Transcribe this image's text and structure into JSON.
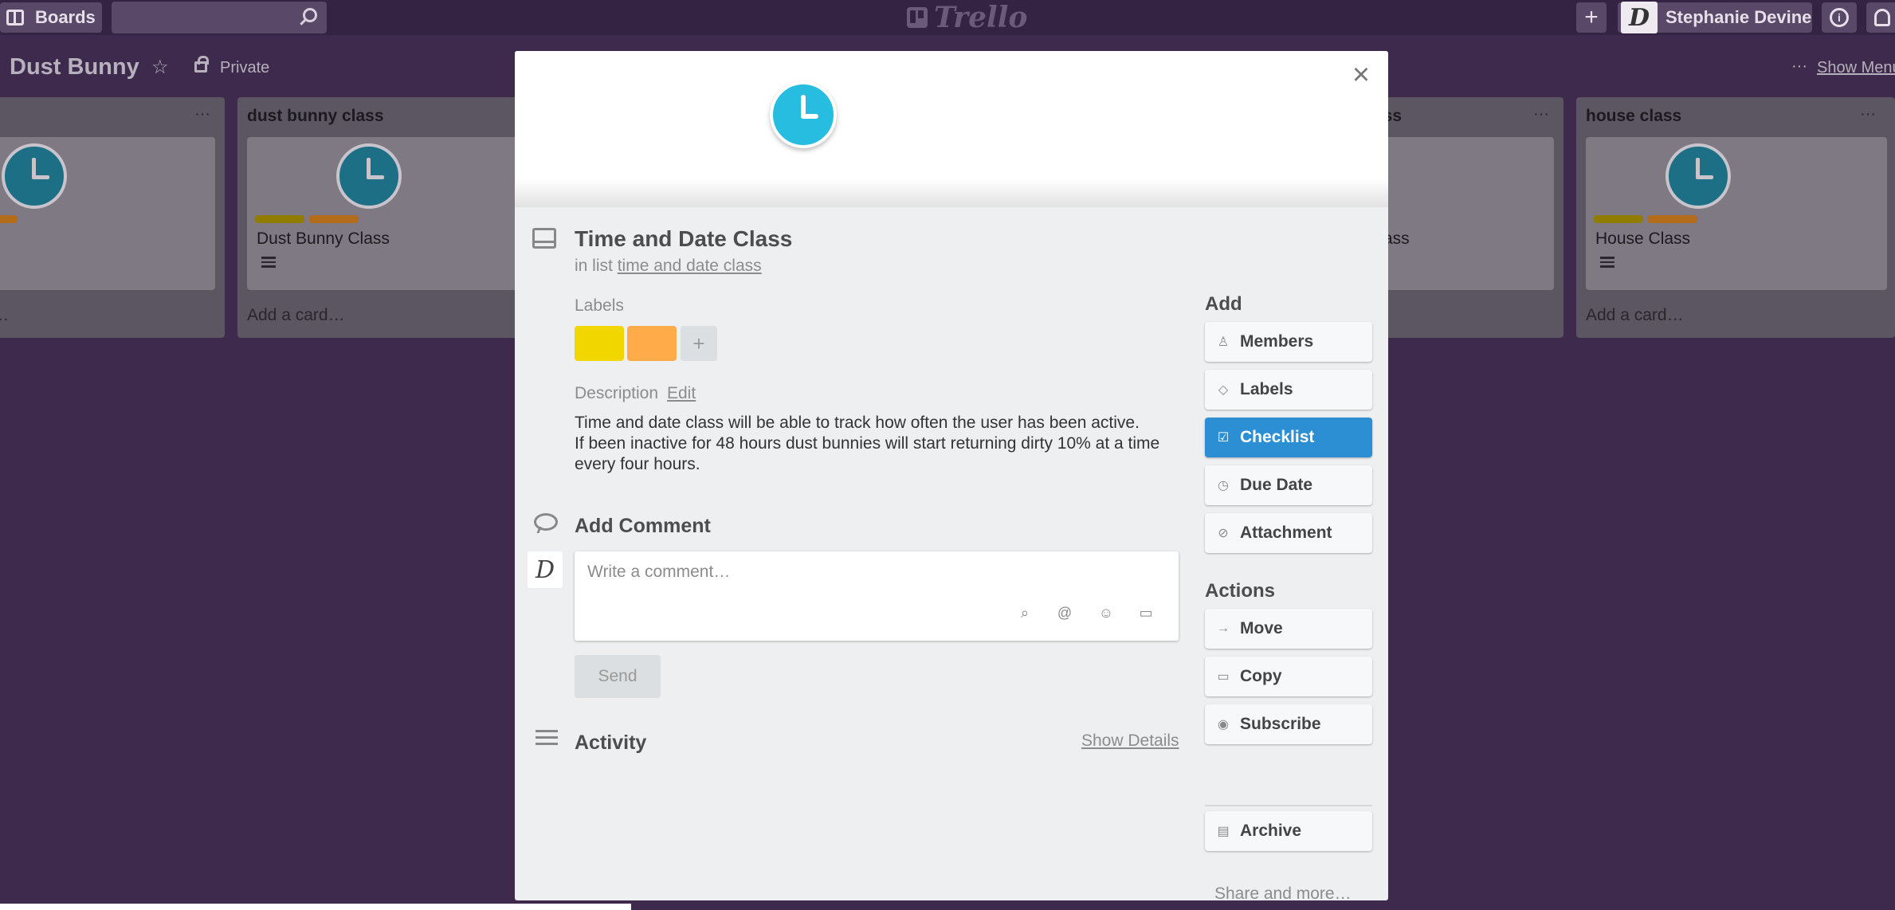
{
  "topbar": {
    "boards_label": "Boards",
    "search_placeholder": "",
    "logo_text": "Trello",
    "user_name": "Stephanie Devine",
    "user_initial": "D",
    "plus_label": "+",
    "info_label": "i"
  },
  "board": {
    "title": "Dust Bunny",
    "privacy": "Private",
    "menu_dots": "···",
    "show_menu": "Show Menu"
  },
  "lists": [
    {
      "title": "",
      "card_title": "",
      "add_card": "Add a card…",
      "label_colors": [
        "#b36d1a"
      ]
    },
    {
      "title": "dust bunny class",
      "card_title": "Dust Bunny Class",
      "add_card": "Add a card…",
      "label_colors": [
        "#8f7c00",
        "#b36d1a"
      ]
    },
    {
      "title": "ass",
      "card_title": "ass",
      "add_card": ""
    },
    {
      "title": "house class",
      "card_title": "House Class",
      "add_card": "Add a card…",
      "label_colors": [
        "#8f7c00",
        "#b36d1a"
      ]
    }
  ],
  "card": {
    "title": "Time and Date Class",
    "in_list_prefix": "in list",
    "list_name": "time and date class",
    "labels_heading": "Labels",
    "label_colors": [
      "#f2d600",
      "#ffab4a"
    ],
    "add_label": "+",
    "description_heading": "Description",
    "edit_link": "Edit",
    "description_line1": "Time and date class will be able to track how often the user has been active.",
    "description_line2": "If been inactive for 48 hours dust bunnies will start returning dirty 10% at a time every four hours.",
    "add_comment_heading": "Add Comment",
    "comment_placeholder": "Write a comment…",
    "send_label": "Send",
    "activity_heading": "Activity",
    "show_details": "Show Details",
    "close_label": "×"
  },
  "sidebar": {
    "add_heading": "Add",
    "add_buttons": [
      "Members",
      "Labels",
      "Checklist",
      "Due Date",
      "Attachment"
    ],
    "actions_heading": "Actions",
    "action_buttons": [
      "Move",
      "Copy",
      "Subscribe",
      "Archive"
    ],
    "share_more": "Share and more…"
  },
  "colors": {
    "accent": "#2c8fd3",
    "board_background": "#3e2a4c",
    "cover_clock": "#26bde0"
  }
}
